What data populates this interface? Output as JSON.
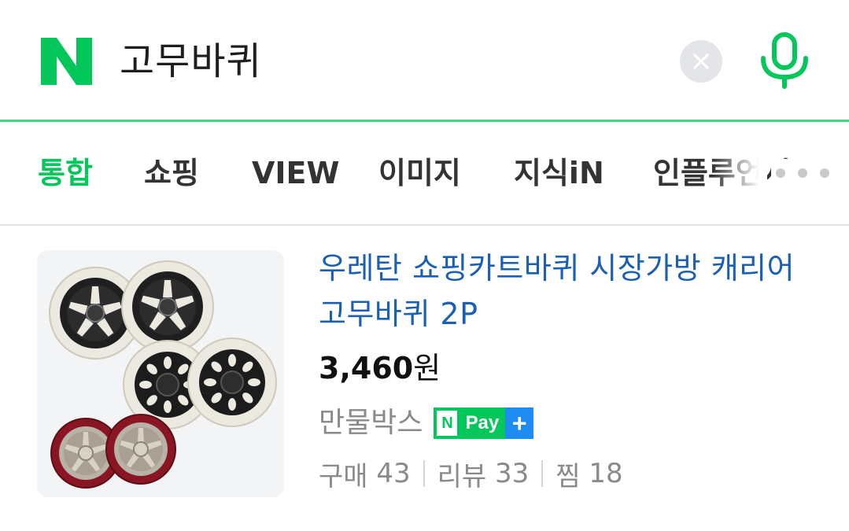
{
  "search": {
    "logo_letter": "N",
    "query": "고무바퀴",
    "clear_icon": "close-icon",
    "mic_icon": "microphone-icon"
  },
  "tabs": [
    {
      "label": "통합",
      "active": true
    },
    {
      "label": "쇼핑",
      "active": false
    },
    {
      "label": "VIEW",
      "active": false
    },
    {
      "label": "이미지",
      "active": false
    },
    {
      "label": "지식iN",
      "active": false
    },
    {
      "label": "인플루언서",
      "active": false
    }
  ],
  "more_icon": "more-dots-icon",
  "product": {
    "title": "우레탄 쇼핑카트바퀴 시장가방 캐리어 고무바퀴 2P",
    "price_number": "3,460",
    "price_unit": "원",
    "store": "만물박스",
    "npay": {
      "n": "N",
      "pay": "Pay",
      "plus": "+"
    },
    "stats": {
      "purchase_label": "구매",
      "purchase_count": "43",
      "review_label": "리뷰",
      "review_count": "33",
      "wish_label": "찜",
      "wish_count": "18"
    }
  },
  "colors": {
    "brand_green": "#03c75a",
    "link_blue": "#1a5fb4",
    "npay_plus_blue": "#1e8bf0",
    "muted_gray": "#8a8a8a"
  }
}
